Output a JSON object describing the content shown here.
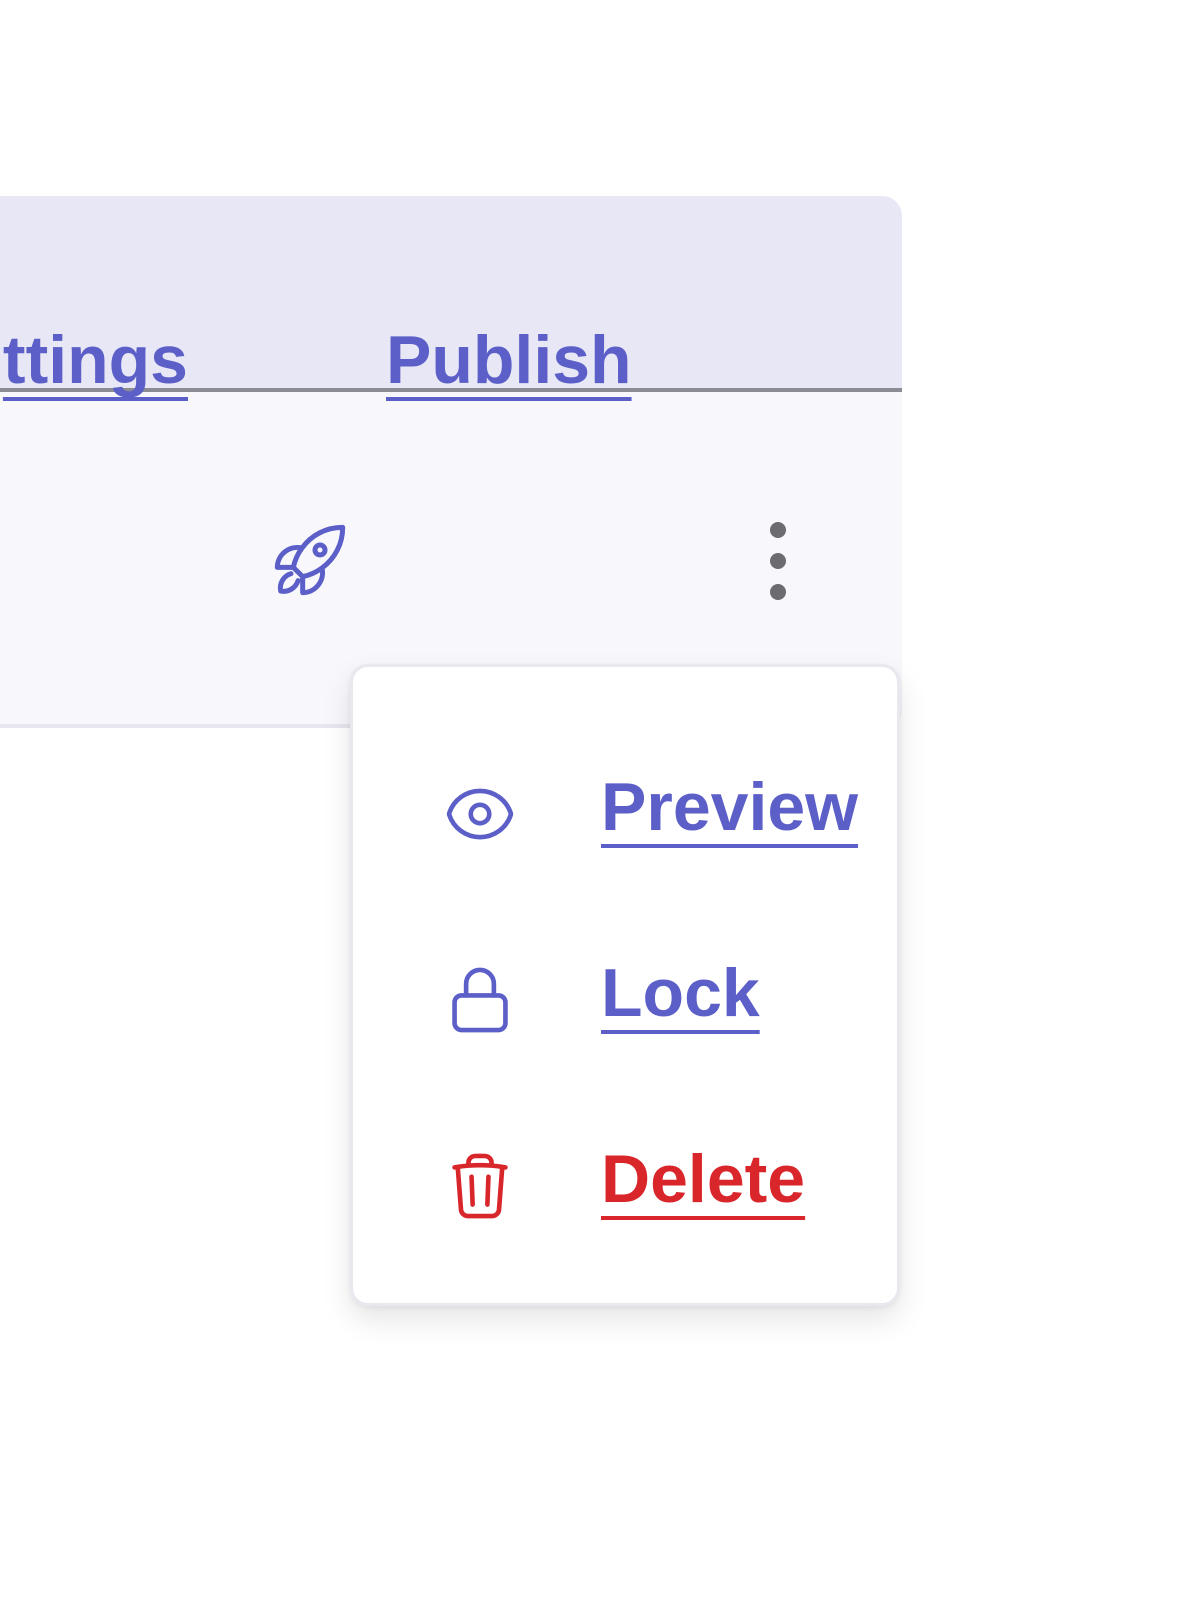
{
  "colors": {
    "accent": "#5b5fc7",
    "danger": "#d9262b",
    "header_bg": "#e7e7f6",
    "toolbar_bg": "#f7f7fc"
  },
  "toolbar": {
    "settings_label": "ttings",
    "publish_label": "Publish",
    "publish_icon": "rocket-icon",
    "more_icon": "more-vertical-icon"
  },
  "menu": {
    "items": [
      {
        "label": "Preview",
        "icon": "eye-icon",
        "tone": "accent"
      },
      {
        "label": "Lock",
        "icon": "lock-icon",
        "tone": "accent"
      },
      {
        "label": "Delete",
        "icon": "trash-icon",
        "tone": "danger"
      }
    ]
  }
}
